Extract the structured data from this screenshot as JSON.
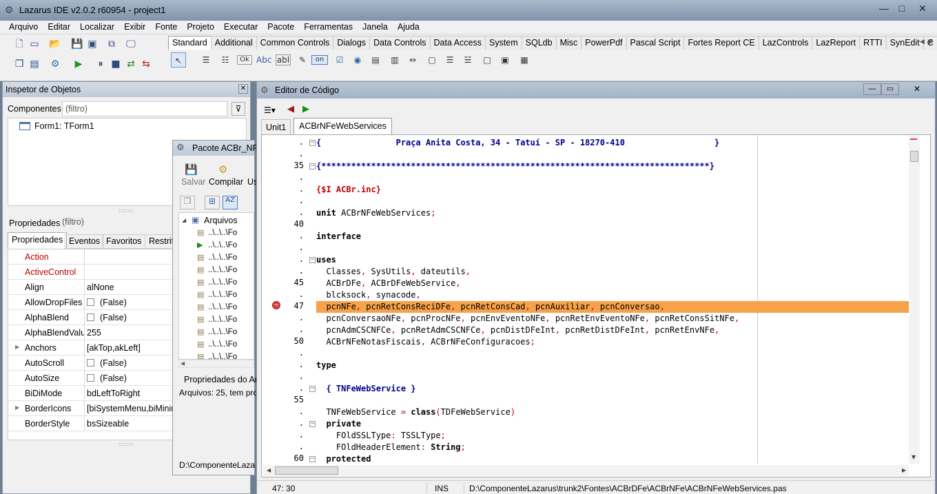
{
  "app": {
    "title": "Lazarus IDE v2.0.2 r60954 - project1",
    "window_buttons": [
      "—",
      "□",
      "✕"
    ]
  },
  "menu": [
    "Arquivo",
    "Editar",
    "Localizar",
    "Exibir",
    "Fonte",
    "Projeto",
    "Executar",
    "Pacote",
    "Ferramentas",
    "Janela",
    "Ajuda"
  ],
  "palette_tabs": [
    "Standard",
    "Additional",
    "Common Controls",
    "Dialogs",
    "Data Controls",
    "Data Access",
    "System",
    "SQLdb",
    "Misc",
    "PowerPdf",
    "Pascal Script",
    "Fortes Report CE",
    "LazControls",
    "LazReport",
    "RTTI",
    "SynEdit",
    "C"
  ],
  "palette_components": [
    "Ok",
    "Abc",
    "abI",
    "on"
  ],
  "inspector": {
    "title": "Inspetor de Objetos",
    "components_label": "Componentes",
    "filter_placeholder": "(filtro)",
    "tree_item": "Form1: TForm1",
    "props_label": "Propriedades",
    "props_filter": "(filtro)",
    "tabs": [
      "Propriedades",
      "Eventos",
      "Favoritos",
      "Restrito"
    ],
    "rows": [
      {
        "name": "Action",
        "value": "",
        "highlight": true
      },
      {
        "name": "ActiveControl",
        "value": "",
        "highlight": true
      },
      {
        "name": "Align",
        "value": "alNone"
      },
      {
        "name": "AllowDropFiles",
        "value": "(False)",
        "check": true
      },
      {
        "name": "AlphaBlend",
        "value": "(False)",
        "check": true
      },
      {
        "name": "AlphaBlendValu",
        "value": "255"
      },
      {
        "name": "Anchors",
        "value": "[akTop,akLeft]",
        "expand": true
      },
      {
        "name": "AutoScroll",
        "value": "(False)",
        "check": true
      },
      {
        "name": "AutoSize",
        "value": "(False)",
        "check": true
      },
      {
        "name": "BiDiMode",
        "value": "bdLeftToRight"
      },
      {
        "name": "BorderIcons",
        "value": "[biSystemMenu,biMinim",
        "expand": true
      },
      {
        "name": "BorderStyle",
        "value": "bsSizeable"
      }
    ]
  },
  "package": {
    "title": "Pacote ACBr_NFe",
    "save": "Salvar",
    "compile": "Compilar",
    "use": "Us",
    "tree_root": "Arquivos",
    "files": [
      "..\\..\\..\\Fo",
      "..\\..\\..\\Fo",
      "..\\..\\..\\Fo",
      "..\\..\\..\\Fo",
      "..\\..\\..\\Fo",
      "..\\..\\..\\Fo",
      "..\\..\\..\\Fo",
      "..\\..\\..\\Fo",
      "..\\..\\..\\Fo",
      "..\\..\\..\\Fo",
      "..\\..\\..\\Fo"
    ],
    "props_title": "Propriedades do Ar",
    "files_count": "Arquivos: 25, tem pro",
    "path": "D:\\ComponenteLaza"
  },
  "editor": {
    "title": "Editor de Código",
    "tabs": [
      "Unit1",
      "ACBrNFeWebServices"
    ],
    "active_tab": "ACBrNFeWebServices",
    "status": {
      "pos": "47: 30",
      "mode": "INS",
      "file": "D:\\ComponenteLazarus\\trunk2\\Fontes\\ACBrDFe\\ACBrNFe\\ACBrNFeWebServices.pas"
    },
    "lines": [
      {
        "ln": ".",
        "text": "{               Praça Anita Costa, 34 - Tatuí - SP - 18270-410                  }",
        "cls": "cm",
        "fold": "□"
      },
      {
        "ln": ".",
        "text": "",
        "cls": ""
      },
      {
        "ln": "35",
        "text": "{******************************************************************************}",
        "cls": "cm",
        "fold": "□"
      },
      {
        "ln": ".",
        "text": "",
        "cls": ""
      },
      {
        "ln": ".",
        "text": "{$I ACBr.inc}",
        "cls": "dr"
      },
      {
        "ln": ".",
        "text": "",
        "cls": ""
      },
      {
        "ln": ".",
        "text": "unit ACBrNFeWebServices;",
        "cls": "mix"
      },
      {
        "ln": "40",
        "text": "",
        "cls": ""
      },
      {
        "ln": ".",
        "text": "interface",
        "cls": "kw"
      },
      {
        "ln": ".",
        "text": "",
        "cls": ""
      },
      {
        "ln": ".",
        "text": "uses",
        "cls": "kw",
        "fold": "□"
      },
      {
        "ln": ".",
        "text": "  Classes, SysUtils, dateutils,",
        "cls": ""
      },
      {
        "ln": "45",
        "text": "  ACBrDFe, ACBrDFeWebService,",
        "cls": ""
      },
      {
        "ln": ".",
        "text": "  blcksock, synacode,",
        "cls": ""
      },
      {
        "ln": "47",
        "text": "  pcnNFe, pcnRetConsReciDFe, pcnRetConsCad, pcnAuxiliar, pcnConversao,",
        "cls": "hl"
      },
      {
        "ln": ".",
        "text": "  pcnConversaoNFe, pcnProcNFe, pcnEnvEventoNFe, pcnRetEnvEventoNFe, pcnRetConsSitNFe,",
        "cls": ""
      },
      {
        "ln": ".",
        "text": "  pcnAdmCSCNFCe, pcnRetAdmCSCNFCe, pcnDistDFeInt, pcnRetDistDFeInt, pcnRetEnvNFe,",
        "cls": ""
      },
      {
        "ln": "50",
        "text": "  ACBrNFeNotasFiscais, ACBrNFeConfiguracoes;",
        "cls": ""
      },
      {
        "ln": ".",
        "text": "",
        "cls": ""
      },
      {
        "ln": ".",
        "text": "type",
        "cls": "kw"
      },
      {
        "ln": ".",
        "text": "",
        "cls": ""
      },
      {
        "ln": ".",
        "text": "  { TNFeWebService }",
        "cls": "cm",
        "fold": "□"
      },
      {
        "ln": "55",
        "text": "",
        "cls": ""
      },
      {
        "ln": ".",
        "text": "  TNFeWebService = class(TDFeWebService)",
        "cls": "mix2"
      },
      {
        "ln": ".",
        "text": "  private",
        "cls": "kw",
        "fold": "□"
      },
      {
        "ln": ".",
        "text": "    FOldSSLType: TSSLType;",
        "cls": ""
      },
      {
        "ln": ".",
        "text": "    FOldHeaderElement: String;",
        "cls": "mix3"
      },
      {
        "ln": "60",
        "text": "  protected",
        "cls": "kw",
        "fold": "□"
      }
    ]
  },
  "colors": {
    "highlight_line": "#f7a24a",
    "comment": "#00008b",
    "directive": "#c00000",
    "property_highlight": "#c00000"
  }
}
